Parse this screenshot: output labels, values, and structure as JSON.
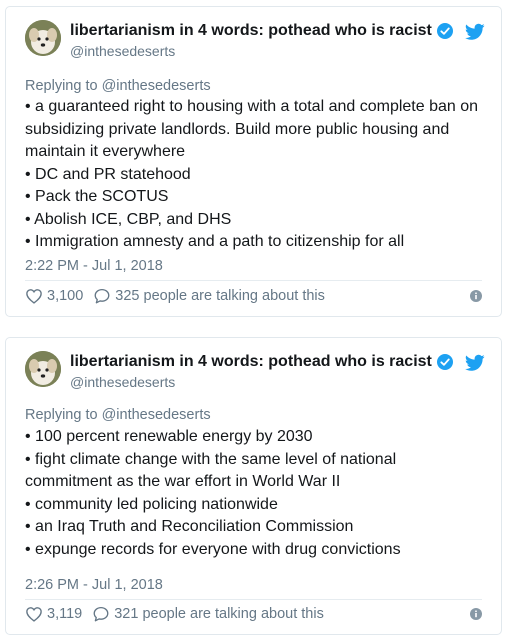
{
  "colors": {
    "text": "#14171a",
    "secondary_text": "#657786",
    "verified_badge": "#1da1f2",
    "twitter_bird": "#1da1f2",
    "border": "#e1e8ed"
  },
  "tweets": [
    {
      "author": {
        "display_name": "libertarianism in 4 words: pothead who is racist",
        "handle": "@inthesedeserts",
        "verified": true,
        "avatar_icon": "dog-avatar"
      },
      "replying_prefix": "Replying to ",
      "replying_to": "@inthesedeserts",
      "lines": [
        "• a guaranteed right to housing with a total and complete ban on subsidizing private landlords. Build more public housing and maintain it everywhere",
        "• DC and PR statehood",
        "• Pack the SCOTUS",
        "• Abolish ICE, CBP, and DHS",
        "• Immigration amnesty and a path to citizenship for all"
      ],
      "timestamp": "2:22 PM - Jul 1, 2018",
      "likes": "3,100",
      "talking": "325 people are talking about this"
    },
    {
      "author": {
        "display_name": "libertarianism in 4 words: pothead who is racist",
        "handle": "@inthesedeserts",
        "verified": true,
        "avatar_icon": "dog-avatar"
      },
      "replying_prefix": "Replying to ",
      "replying_to": "@inthesedeserts",
      "lines": [
        "• 100 percent renewable energy by 2030",
        "• fight climate change with the same level of national commitment as the war effort in World War II",
        "• community led policing nationwide",
        "• an Iraq Truth and Reconciliation Commission",
        "• expunge records for everyone with drug convictions"
      ],
      "timestamp": "2:26 PM - Jul 1, 2018",
      "likes": "3,119",
      "talking": "321 people are talking about this"
    }
  ]
}
